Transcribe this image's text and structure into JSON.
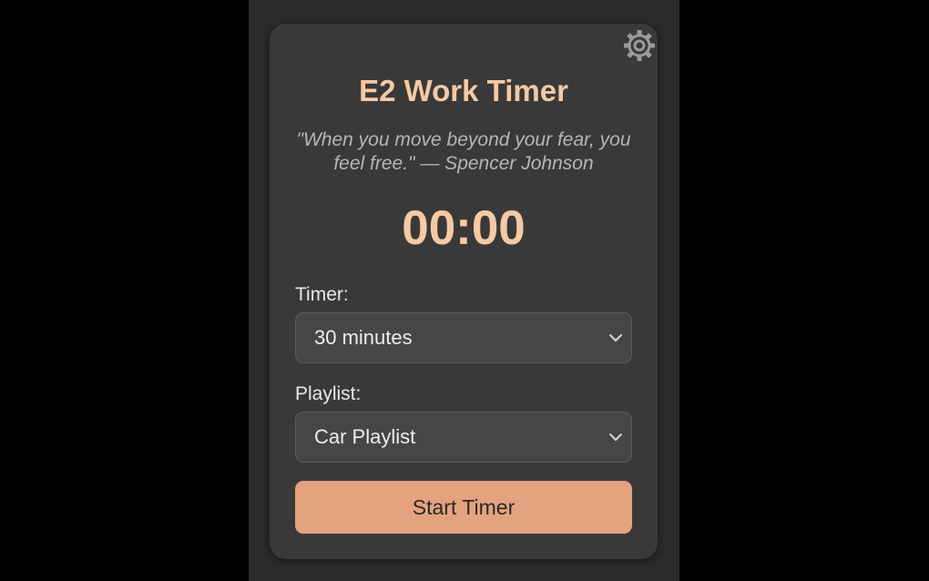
{
  "app": {
    "title": "E2 Work Timer",
    "quote": "\"When you move beyond your fear, you feel free.\" — Spencer Johnson",
    "clock": "00:00"
  },
  "settings": {
    "icon": "gear-icon"
  },
  "timer": {
    "label": "Timer:",
    "selected": "30 minutes"
  },
  "playlist": {
    "label": "Playlist:",
    "selected": "Car Playlist"
  },
  "actions": {
    "start_label": "Start Timer"
  },
  "colors": {
    "accent": "#f6c9a3",
    "button": "#e5a27e",
    "card": "#393939",
    "panel": "#2b2b2b",
    "background": "#000000"
  }
}
